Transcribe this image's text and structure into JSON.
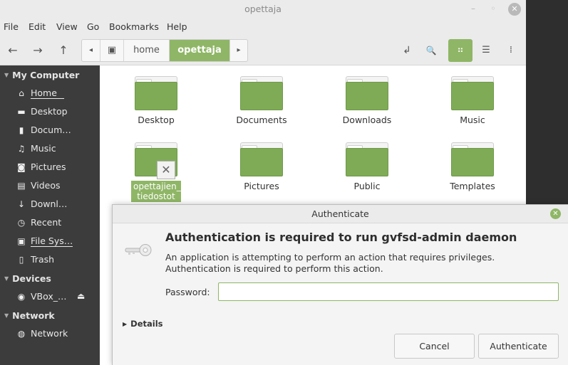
{
  "window": {
    "title": "opettaja",
    "minimize_glyph": "–",
    "maximize_glyph": "◦",
    "close_glyph": "✕"
  },
  "menubar": {
    "items": [
      "File",
      "Edit",
      "View",
      "Go",
      "Bookmarks",
      "Help"
    ]
  },
  "toolbar": {
    "back_icon": "←",
    "forward_icon": "→",
    "up_icon": "↑",
    "path_prev_icon": "◂",
    "path_next_icon": "▸",
    "path": [
      {
        "label": "home",
        "active": false
      },
      {
        "label": "opettaja",
        "active": true
      }
    ],
    "toggle_location_icon": "↲",
    "search_icon": "🔍",
    "view_icons_icon": "⠶",
    "view_list_icon": "☰",
    "view_compact_icon": "⁞"
  },
  "sidebar": {
    "sections": [
      {
        "title": "My Computer"
      },
      {
        "title": "Devices"
      },
      {
        "title": "Network"
      }
    ],
    "items": [
      {
        "label": "Home",
        "icon": "⌂"
      },
      {
        "label": "Desktop",
        "icon": "▬"
      },
      {
        "label": "Docum…",
        "icon": "▮"
      },
      {
        "label": "Music",
        "icon": "♫"
      },
      {
        "label": "Pictures",
        "icon": "◙"
      },
      {
        "label": "Videos",
        "icon": "▤"
      },
      {
        "label": "Downl…",
        "icon": "↓"
      },
      {
        "label": "Recent",
        "icon": "◷"
      },
      {
        "label": "File Sys…",
        "icon": "▣"
      },
      {
        "label": "Trash",
        "icon": "▯"
      },
      {
        "label": "VBox_…",
        "icon": "◉"
      },
      {
        "label": "Network",
        "icon": "◍"
      }
    ],
    "eject_icon": "⏏"
  },
  "content": {
    "folders": [
      {
        "label": "Desktop"
      },
      {
        "label": "Documents"
      },
      {
        "label": "Downloads"
      },
      {
        "label": "Music"
      },
      {
        "label": "opettajien_ tiedostot"
      },
      {
        "label": "Pictures"
      },
      {
        "label": "Public"
      },
      {
        "label": "Templates"
      }
    ],
    "no_access_emblem": "✕"
  },
  "dialog": {
    "title": "Authenticate",
    "close_glyph": "✕",
    "heading": "Authentication is required to run gvfsd-admin daemon",
    "message": "An application is attempting to perform an action that requires privileges. Authentication is required to perform this action.",
    "password_label": "Password:",
    "password_value": "",
    "details_label": "Details",
    "cancel_label": "Cancel",
    "authenticate_label": "Authenticate"
  },
  "colors": {
    "accent": "#8fb666",
    "folder": "#7fab57",
    "sidebar_bg": "#3c3c3c"
  }
}
